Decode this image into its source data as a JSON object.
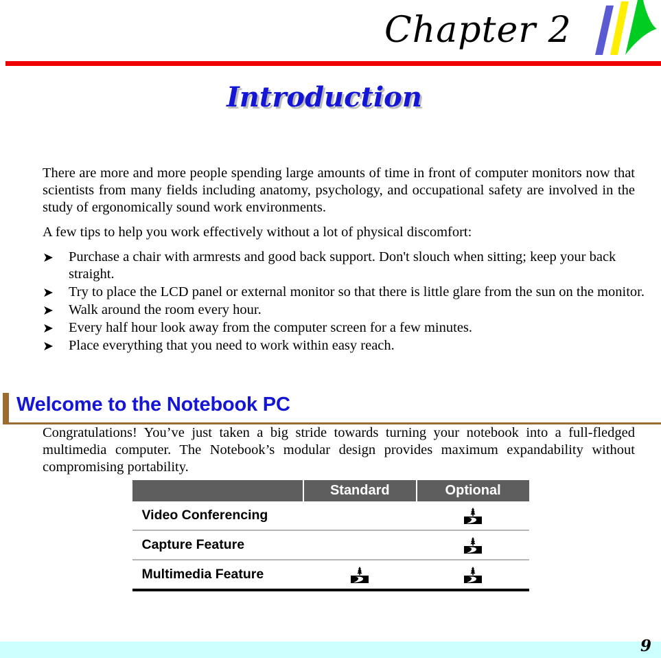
{
  "header": {
    "chapter_label": "Chapter  2",
    "logo_name": "swoosh-logo",
    "rule_color": "#ee0000",
    "logo_colors": {
      "blue": "#5a5ad2",
      "yellow": "#ffee00",
      "green": "#00cc22"
    }
  },
  "page_title": {
    "text": "Introduction",
    "color": "#1515d6",
    "shadow_color": "#b9b9b9"
  },
  "intro": {
    "paragraph": "There are more and more people spending large amounts of time in front of computer monitors now that scientists from many fields including anatomy, psychology, and occupational safety are involved in the study of ergonomically sound work environments.",
    "tips_lead": "A few tips to help you work effectively without a lot of physical discomfort:",
    "bullet_glyph": "➤",
    "tips": [
      "Purchase a chair with armrests and good back support.  Don't slouch when sitting; keep your back straight.",
      "Try to place the LCD panel or external monitor so that there is little glare from the sun on the monitor.",
      "Walk around the room every hour.",
      "Every half hour look away from the computer screen for a few minutes.",
      "Place everything that you need to work within easy reach."
    ]
  },
  "section": {
    "heading": "Welcome to the Notebook PC",
    "heading_color": "#1515d6",
    "accent_bar_color": "#9c6b2f",
    "paragraph": "Congratulations! You’ve just taken a big stride towards turning your notebook into a full-fledged multimedia computer. The Notebook’s modular design provides maximum expandability without compromising portability."
  },
  "feature_table": {
    "header_bg": "#5e5e5e",
    "columns": [
      "",
      "Standard",
      "Optional"
    ],
    "mark_icon": "tree-road-icon",
    "rows": [
      {
        "feature": "Video Conferencing",
        "standard": false,
        "optional": true
      },
      {
        "feature": "Capture Feature",
        "standard": false,
        "optional": true
      },
      {
        "feature": "Multimedia Feature",
        "standard": true,
        "optional": true
      }
    ]
  },
  "footer": {
    "page_number": "9",
    "band_color": "#ccffff"
  }
}
